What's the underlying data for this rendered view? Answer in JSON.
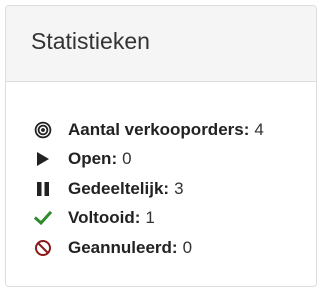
{
  "panel": {
    "title": "Statistieken"
  },
  "stats": [
    {
      "icon": "bullseye-icon",
      "label": "Aantal verkooporders:",
      "value": "4",
      "color": "#222222"
    },
    {
      "icon": "play-icon",
      "label": "Open:",
      "value": "0",
      "color": "#222222"
    },
    {
      "icon": "pause-icon",
      "label": "Gedeeltelijk:",
      "value": "3",
      "color": "#222222"
    },
    {
      "icon": "check-icon",
      "label": "Voltooid:",
      "value": "1",
      "color": "#2e8b2e"
    },
    {
      "icon": "ban-icon",
      "label": "Geannuleerd:",
      "value": "0",
      "color": "#8b1a1a"
    }
  ]
}
